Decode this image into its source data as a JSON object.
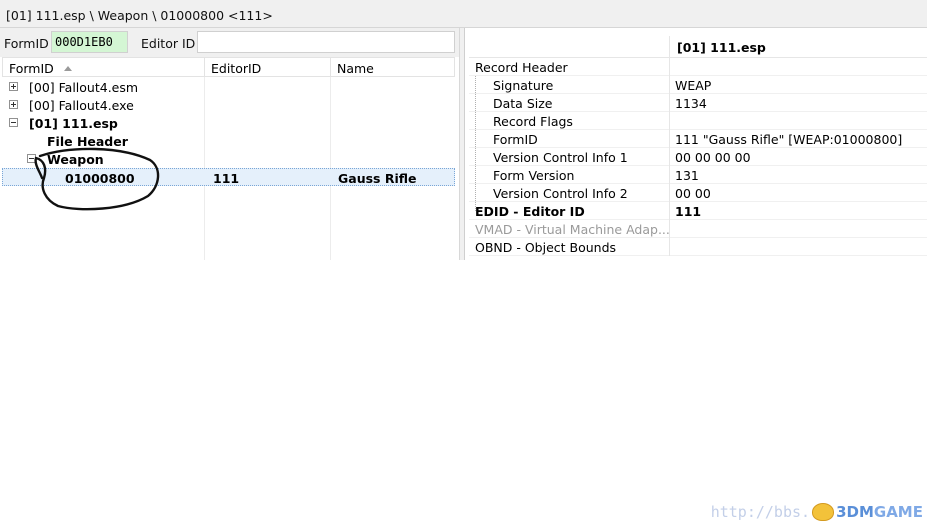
{
  "path_bar": {
    "text": "[01] 111.esp \\ Weapon \\ 01000800  <111>"
  },
  "filter": {
    "formid_label": "FormID",
    "formid_value": "000D1EB0",
    "editorid_label": "Editor ID",
    "editorid_value": ""
  },
  "tree": {
    "columns": [
      "FormID",
      "EditorID",
      "Name"
    ],
    "sort_indicator": "sort-ascending-icon",
    "rows": [
      {
        "label": "[00] Fallout4.esm",
        "editor_id": "",
        "name": "",
        "expander": "plus"
      },
      {
        "label": "[00] Fallout4.exe",
        "editor_id": "",
        "name": "",
        "expander": "plus"
      },
      {
        "label": "[01] 111.esp",
        "editor_id": "",
        "name": "",
        "expander": "minus"
      },
      {
        "label": "File Header",
        "editor_id": "",
        "name": "",
        "expander": ""
      },
      {
        "label": "Weapon",
        "editor_id": "",
        "name": "",
        "expander": "minus"
      },
      {
        "label": "01000800",
        "editor_id": "111",
        "name": "Gauss Rifle",
        "expander": "",
        "selected": true
      }
    ]
  },
  "details": {
    "header": "[01] 111.esp",
    "rows": [
      {
        "key": "Record Header",
        "value": ""
      },
      {
        "key": "Signature",
        "value": "WEAP"
      },
      {
        "key": "Data Size",
        "value": "1134"
      },
      {
        "key": "Record Flags",
        "value": ""
      },
      {
        "key": "FormID",
        "value": "111 \"Gauss Rifle\" [WEAP:01000800]"
      },
      {
        "key": "Version Control Info 1",
        "value": "00 00 00 00"
      },
      {
        "key": "Form Version",
        "value": "131"
      },
      {
        "key": "Version Control Info 2",
        "value": "00 00"
      },
      {
        "key": "EDID - Editor ID",
        "value": "111"
      },
      {
        "key": "VMAD - Virtual Machine Adap...",
        "value": ""
      },
      {
        "key": "OBND - Object Bounds",
        "value": ""
      }
    ]
  },
  "watermark": {
    "url": "http://bbs.",
    "brand_a": "3DM",
    "brand_b": "GAME"
  },
  "colors": {
    "formid_field_bg": "#d4f6d4",
    "selection_bg": "#e5f0fb",
    "watermark": "#5a8fd8"
  }
}
